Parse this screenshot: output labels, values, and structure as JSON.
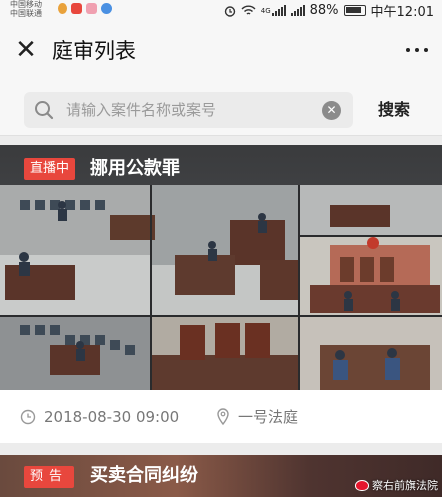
{
  "status_bar": {
    "carrier1": "中国移动",
    "carrier2": "中国联通",
    "battery": "88%",
    "time": "中午12:01",
    "network": "4G"
  },
  "navbar": {
    "title": "庭审列表"
  },
  "search": {
    "placeholder": "请输入案件名称或案号",
    "button_label": "搜索"
  },
  "cases": [
    {
      "badge": "直播中",
      "title": "挪用公款罪",
      "datetime": "2018-08-30 09:00",
      "court": "一号法庭"
    },
    {
      "badge": "预告",
      "title": "买卖合同纠纷"
    }
  ],
  "watermark": "察右前旗法院",
  "colors": {
    "badge": "#e8473d",
    "accent_text": "#777777",
    "background": "#ececec"
  }
}
